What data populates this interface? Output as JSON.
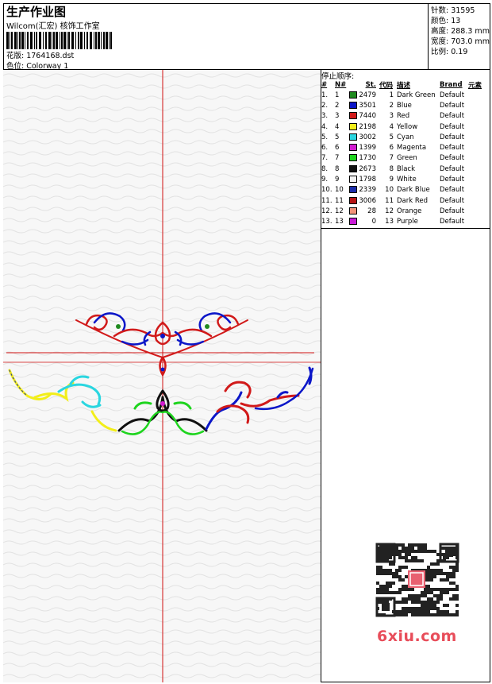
{
  "header": {
    "title": "生产作业图",
    "subtitle": "Wilcom(汇宏) 核饰工作室",
    "design_label": "花版: 1764168.dst",
    "colorway_label": "色位: Colorway 1"
  },
  "stats": {
    "stitches": "针数: 31595",
    "colors": "颜色: 13",
    "height": "高度: 288.3 mm",
    "width": "宽度: 703.0 mm",
    "scale": "比例: 0.19"
  },
  "stop_sequence": {
    "title": "停止顺序:",
    "headers": [
      "#",
      "N#",
      "St.",
      "代码",
      "描述",
      "Brand",
      "元素"
    ],
    "rows": [
      {
        "idx": "1.",
        "n": "1",
        "color": "#1f8a1f",
        "st": "2479",
        "code": "1",
        "desc": "Dark Green",
        "brand": "Default"
      },
      {
        "idx": "2.",
        "n": "2",
        "color": "#0b16c8",
        "st": "3501",
        "code": "2",
        "desc": "Blue",
        "brand": "Default"
      },
      {
        "idx": "3.",
        "n": "3",
        "color": "#d11a1a",
        "st": "7440",
        "code": "3",
        "desc": "Red",
        "brand": "Default"
      },
      {
        "idx": "4.",
        "n": "4",
        "color": "#f2ee1a",
        "st": "2198",
        "code": "4",
        "desc": "Yellow",
        "brand": "Default"
      },
      {
        "idx": "5.",
        "n": "5",
        "color": "#2ad6e0",
        "st": "3002",
        "code": "5",
        "desc": "Cyan",
        "brand": "Default"
      },
      {
        "idx": "6.",
        "n": "6",
        "color": "#d21ad0",
        "st": "1399",
        "code": "6",
        "desc": "Magenta",
        "brand": "Default"
      },
      {
        "idx": "7.",
        "n": "7",
        "color": "#1ed41e",
        "st": "1730",
        "code": "7",
        "desc": "Green",
        "brand": "Default"
      },
      {
        "idx": "8.",
        "n": "8",
        "color": "#111111",
        "st": "2673",
        "code": "8",
        "desc": "Black",
        "brand": "Default"
      },
      {
        "idx": "9.",
        "n": "9",
        "color": "#f4f4f4",
        "st": "1798",
        "code": "9",
        "desc": "White",
        "brand": "Default"
      },
      {
        "idx": "10.",
        "n": "10",
        "color": "#1a2ca8",
        "st": "2339",
        "code": "10",
        "desc": "Dark Blue",
        "brand": "Default"
      },
      {
        "idx": "11.",
        "n": "11",
        "color": "#b51414",
        "st": "3006",
        "code": "11",
        "desc": "Dark Red",
        "brand": "Default"
      },
      {
        "idx": "12.",
        "n": "12",
        "color": "#f2937a",
        "st": "28",
        "code": "12",
        "desc": "Orange",
        "brand": "Default"
      },
      {
        "idx": "13.",
        "n": "13",
        "color": "#c81ad6",
        "st": "0",
        "code": "13",
        "desc": "Purple",
        "brand": "Default"
      }
    ]
  },
  "watermark": {
    "text": "6xiu.com"
  },
  "colors": {
    "crosshair": "#d01010",
    "border": "#000000"
  }
}
